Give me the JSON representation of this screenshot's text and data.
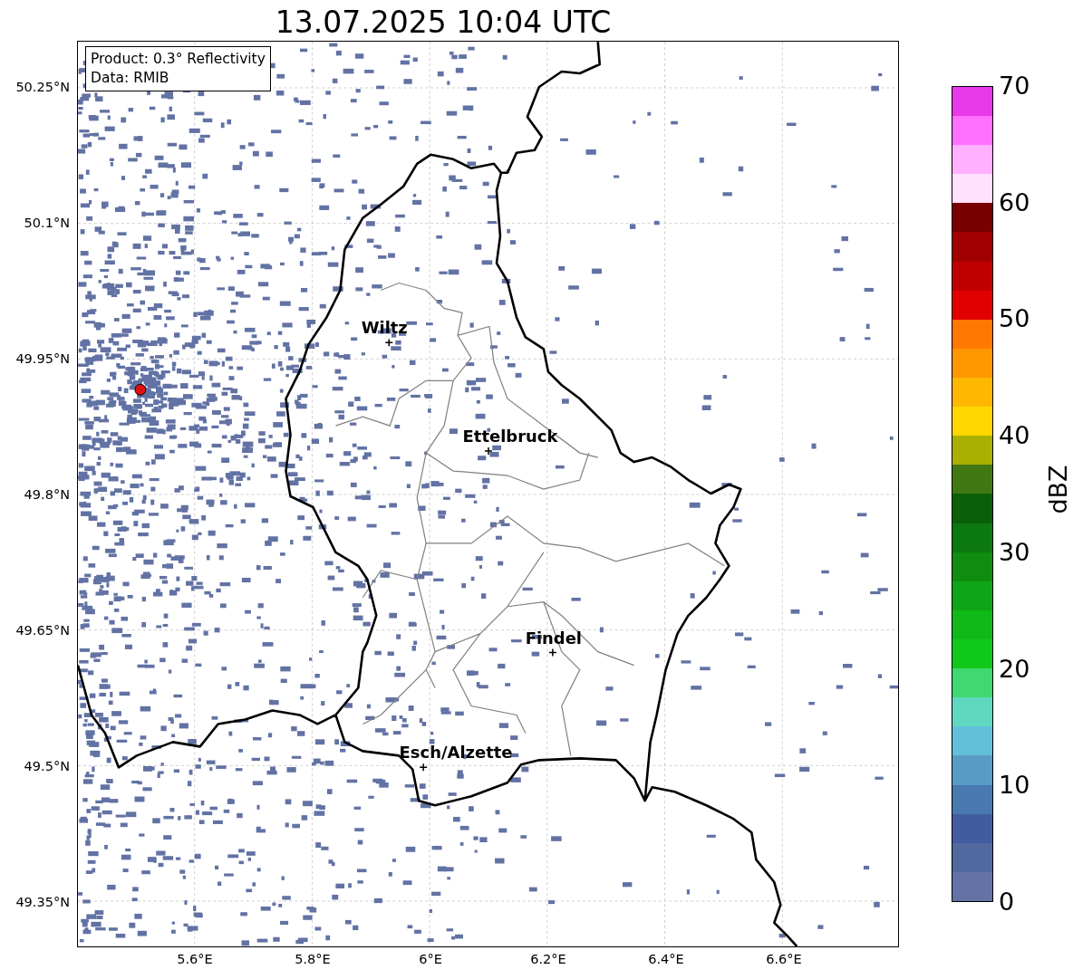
{
  "title": "13.07.2025 10:04 UTC",
  "map": {
    "legend": [
      "Product: 0.3° Reflectivity",
      "Data: RMIB"
    ],
    "lat_ticks": [
      "50.25°N",
      "50.1°N",
      "49.95°N",
      "49.8°N",
      "49.65°N",
      "49.5°N",
      "49.35°N"
    ],
    "lon_ticks": [
      "5.6°E",
      "5.8°E",
      "6°E",
      "6.2°E",
      "6.4°E",
      "6.6°E"
    ],
    "cities": [
      {
        "name": "Wiltz"
      },
      {
        "name": "Ettelbruck"
      },
      {
        "name": "Findel"
      },
      {
        "name": "Esch/Alzette"
      }
    ]
  },
  "colorbar": {
    "label": "dBZ",
    "ticks": [
      "70",
      "60",
      "50",
      "40",
      "30",
      "20",
      "10",
      "0"
    ],
    "segments": [
      {
        "color": "#6472a5"
      },
      {
        "color": "#52699f"
      },
      {
        "color": "#425d9f"
      },
      {
        "color": "#4a78b0"
      },
      {
        "color": "#589cc6"
      },
      {
        "color": "#62c0d8"
      },
      {
        "color": "#60d8c0"
      },
      {
        "color": "#40d870"
      },
      {
        "color": "#10c818"
      },
      {
        "color": "#10b818"
      },
      {
        "color": "#10a418"
      },
      {
        "color": "#108c10"
      },
      {
        "color": "#0c7810"
      },
      {
        "color": "#0a6008"
      },
      {
        "color": "#427812"
      },
      {
        "color": "#aab000"
      },
      {
        "color": "#ffd800"
      },
      {
        "color": "#ffb800"
      },
      {
        "color": "#ff9800"
      },
      {
        "color": "#ff7800"
      },
      {
        "color": "#e00000"
      },
      {
        "color": "#c00000"
      },
      {
        "color": "#a00000"
      },
      {
        "color": "#780000"
      },
      {
        "color": "#ffe0ff"
      },
      {
        "color": "#ffb0ff"
      },
      {
        "color": "#ff70ff"
      },
      {
        "color": "#e838e8"
      }
    ]
  }
}
